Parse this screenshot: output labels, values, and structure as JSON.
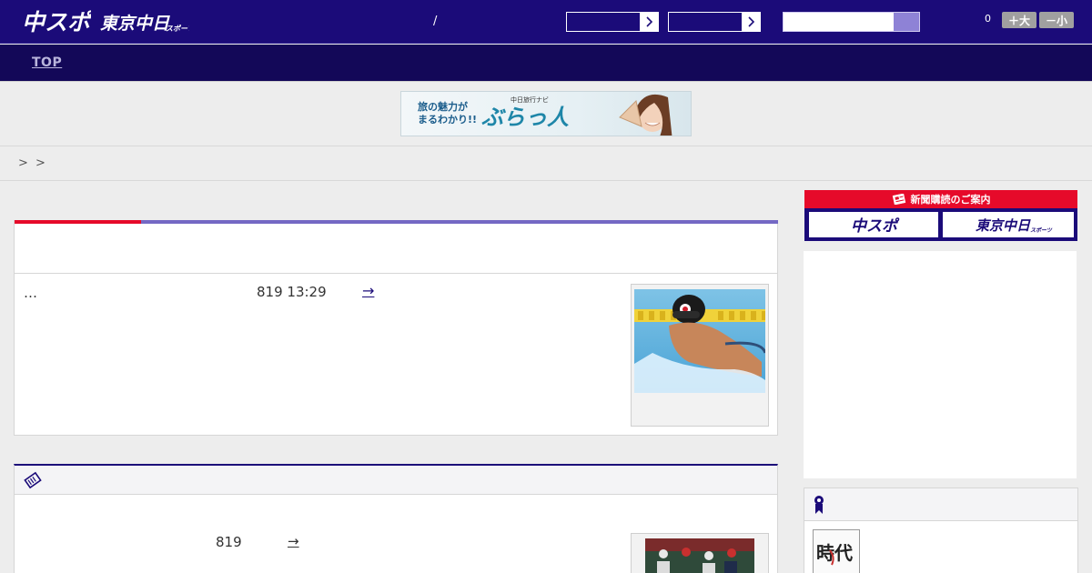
{
  "header": {
    "logo_primary": "中スポ",
    "logo_secondary": "東京中日",
    "logo_secondary_small": "スポーツ",
    "date_separator": "/",
    "select_one_value": "",
    "select_two_value": "",
    "search_placeholder": "",
    "font_size_count": "0",
    "font_larger_label": "＋大",
    "font_smaller_label": "－小",
    "colors": {
      "primary": "#1b0b79",
      "nav": "#130858",
      "accent_red": "#e60a2a"
    }
  },
  "nav": {
    "top_label": "TOP"
  },
  "banner": {
    "copy_line1": "旅の魅力が",
    "copy_line2": "まるわかり!!",
    "service": "中日旅行ナビ",
    "brand": "ぶらっ人"
  },
  "breadcrumb": {
    "text": "> >"
  },
  "main": {
    "lead_article": {
      "excerpt": "…",
      "meta": "819 13:29",
      "more_arrow": "→"
    },
    "second_article": {
      "meta": "819",
      "more_arrow": "→"
    }
  },
  "sidebar": {
    "subscription_title": "新聞購読のご案内",
    "subscription_logo_1": "中スポ",
    "subscription_logo_2": "東京中日",
    "subscription_logo_2_small": "スポーツ",
    "book_title": "時代"
  },
  "icons": {
    "select_arrow": "chevron-right-icon",
    "panel2_heading": "ticket-icon",
    "ranking_heading": "medal-icon",
    "subscription": "newspaper-icon"
  }
}
